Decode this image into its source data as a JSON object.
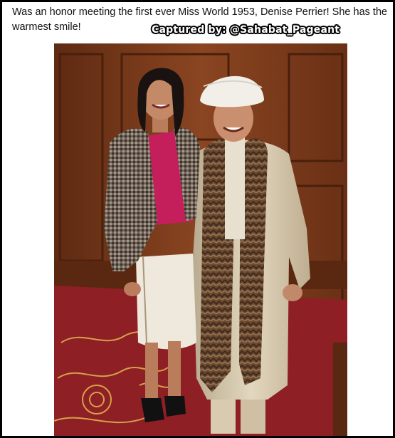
{
  "post": {
    "caption": "Was an honor meeting the first ever Miss World 1953, Denise Perrier! She has the warmest smile!",
    "watermark": "Captured by: @Sahabat_Pageant"
  },
  "colors": {
    "frame_border": "#000000",
    "background": "#ffffff",
    "wood_panel": "#7a3a1c",
    "carpet": "#8e1f24",
    "carpet_pattern": "#d4a24c",
    "blouse": "#c41e5b",
    "coat": "#d9cdb2",
    "fur": "#6b4a32"
  }
}
